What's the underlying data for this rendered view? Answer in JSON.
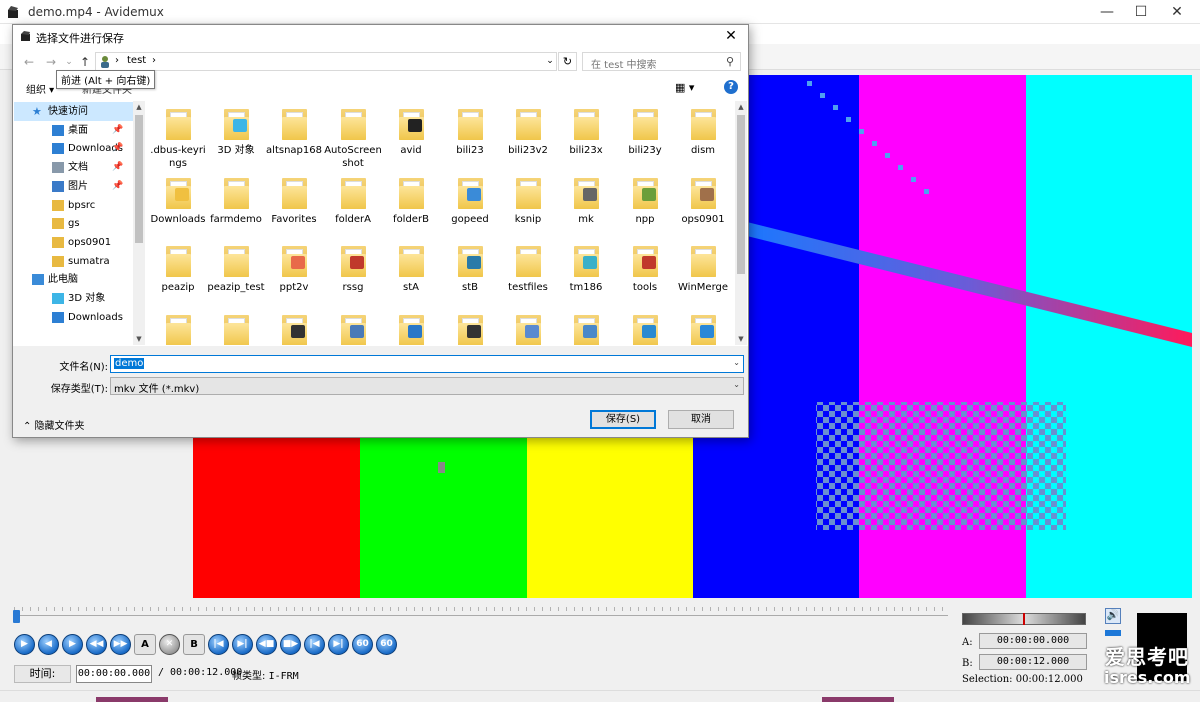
{
  "main_window": {
    "title": "demo.mp4 - Avidemux",
    "controls": {
      "minimize": "—",
      "maximize": "☐",
      "close": "✕"
    }
  },
  "video_bars": [
    {
      "color": "#ff0000"
    },
    {
      "color": "#00ff00"
    },
    {
      "color": "#ffff00"
    },
    {
      "color": "#0000ff"
    },
    {
      "color": "#ff00ff"
    },
    {
      "color": "#00ffff"
    }
  ],
  "playback": {
    "buttons": [
      {
        "name": "play-button",
        "label": "▶"
      },
      {
        "name": "previous-frame-button",
        "label": "◀"
      },
      {
        "name": "next-frame-button",
        "label": "▶"
      },
      {
        "name": "previous-keyframe-button",
        "label": "◀◀"
      },
      {
        "name": "next-keyframe-button",
        "label": "▶▶"
      },
      {
        "name": "set-marker-a-button",
        "label": "A",
        "style": "ab"
      },
      {
        "name": "delete-button",
        "label": "✕",
        "style": "del"
      },
      {
        "name": "set-marker-b-button",
        "label": "B",
        "style": "ab"
      },
      {
        "name": "goto-marker-a-button",
        "label": "|◀"
      },
      {
        "name": "goto-marker-b-button",
        "label": "▶|"
      },
      {
        "name": "previous-black-frame-button",
        "label": "◀■"
      },
      {
        "name": "next-black-frame-button",
        "label": "■▶"
      },
      {
        "name": "first-frame-button",
        "label": "|◀"
      },
      {
        "name": "last-frame-button",
        "label": "▶|"
      },
      {
        "name": "back-60-button",
        "label": "60"
      },
      {
        "name": "forward-60-button",
        "label": "60"
      }
    ],
    "time_label": "时间:",
    "current_time": "00:00:00.000",
    "total_time": "/ 00:00:12.000",
    "frame_type_label": "帧类型:",
    "frame_type_value": "I-FRM",
    "marker_a_label": "A:",
    "marker_a_time": "00:00:00.000",
    "marker_b_label": "B:",
    "marker_b_time": "00:00:12.000",
    "selection": "Selection: 00:00:12.000",
    "speaker_icon": "🔊"
  },
  "watermark": {
    "zh": "爱思考吧",
    "en": "isres.com"
  },
  "dialog": {
    "title": "选择文件进行保存",
    "close": "✕",
    "back": "←",
    "forward": "→",
    "dropdown": "⌄",
    "up": "↑",
    "breadcrumb_sep": "›",
    "current_folder": "test",
    "refresh": "↻",
    "search_placeholder": "在 test 中搜索",
    "tooltip": "前进 (Alt + 向右键)",
    "organize": "组织 ▾",
    "new_folder": "新建文件夹",
    "view": "▦ ▾",
    "help": "?",
    "nav_items": [
      {
        "label": "快速访问",
        "icon": "star-icon",
        "indent": 20,
        "selected": true,
        "pin": false
      },
      {
        "label": "桌面",
        "icon": "desktop-icon",
        "indent": 40,
        "pin": true
      },
      {
        "label": "Downloads",
        "icon": "download-icon",
        "indent": 40,
        "pin": true
      },
      {
        "label": "文档",
        "icon": "document-icon",
        "indent": 40,
        "pin": true
      },
      {
        "label": "图片",
        "icon": "picture-icon",
        "indent": 40,
        "pin": true
      },
      {
        "label": "bpsrc",
        "icon": "folder-icon",
        "indent": 40,
        "pin": false
      },
      {
        "label": "gs",
        "icon": "folder-icon",
        "indent": 40,
        "pin": false
      },
      {
        "label": "ops0901",
        "icon": "folder-icon",
        "indent": 40,
        "pin": false
      },
      {
        "label": "sumatra",
        "icon": "folder-icon",
        "indent": 40,
        "pin": false
      },
      {
        "label": "此电脑",
        "icon": "computer-icon",
        "indent": 20,
        "pin": false
      },
      {
        "label": "3D 对象",
        "icon": "3d-objects-icon",
        "indent": 40,
        "pin": false
      },
      {
        "label": "Downloads",
        "icon": "download-icon",
        "indent": 40,
        "pin": false
      }
    ],
    "pin_glyph": "📌",
    "files": [
      {
        "name": ".dbus-keyrings"
      },
      {
        "name": "3D 对象",
        "badge": "#3db5e6"
      },
      {
        "name": "altsnap168"
      },
      {
        "name": "AutoScreenshot"
      },
      {
        "name": "avid",
        "badge": "#222"
      },
      {
        "name": "bili23"
      },
      {
        "name": "bili23v2"
      },
      {
        "name": "bili23x"
      },
      {
        "name": "bili23y"
      },
      {
        "name": "dism"
      },
      {
        "name": "Downloads",
        "badge": "#f0c040"
      },
      {
        "name": "farmdemo"
      },
      {
        "name": "Favorites"
      },
      {
        "name": "folderA"
      },
      {
        "name": "folderB"
      },
      {
        "name": "gopeed",
        "badge": "#3a8bd8"
      },
      {
        "name": "ksnip"
      },
      {
        "name": "mk",
        "badge": "#666"
      },
      {
        "name": "npp",
        "badge": "#6b9e3a"
      },
      {
        "name": "ops0901",
        "badge": "#a0704a"
      },
      {
        "name": "peazip"
      },
      {
        "name": "peazip_test"
      },
      {
        "name": "ppt2v",
        "badge": "#e86a4a"
      },
      {
        "name": "rssg",
        "badge": "#c0392b"
      },
      {
        "name": "stA"
      },
      {
        "name": "stB",
        "badge": "#2a7aa8"
      },
      {
        "name": "testfiles"
      },
      {
        "name": "tm186",
        "badge": "#3ab0c8"
      },
      {
        "name": "tools",
        "badge": "#c0392b"
      },
      {
        "name": "WinMerge"
      },
      {
        "name": "",
        "badge": ""
      },
      {
        "name": "",
        "badge": ""
      },
      {
        "name": "",
        "badge": "#333"
      },
      {
        "name": "",
        "badge": "#4a7ab8"
      },
      {
        "name": "",
        "badge": "#2a78c8"
      },
      {
        "name": "",
        "badge": "#333"
      },
      {
        "name": "",
        "badge": "#5a8ad0"
      },
      {
        "name": "",
        "badge": "#4a88c8"
      },
      {
        "name": "",
        "badge": "#2a8ad0"
      },
      {
        "name": "",
        "badge": "#2a88d8"
      }
    ],
    "filename_label": "文件名(N):",
    "filename_value": "demo",
    "filetype_label": "保存类型(T):",
    "filetype_value": "mkv 文件 (*.mkv)",
    "hide_folders": "⌃  隐藏文件夹",
    "save_button": "保存(S)",
    "cancel_button": "取消",
    "scroll_up": "▲",
    "scroll_down": "▼",
    "search_icon": "⚲"
  }
}
